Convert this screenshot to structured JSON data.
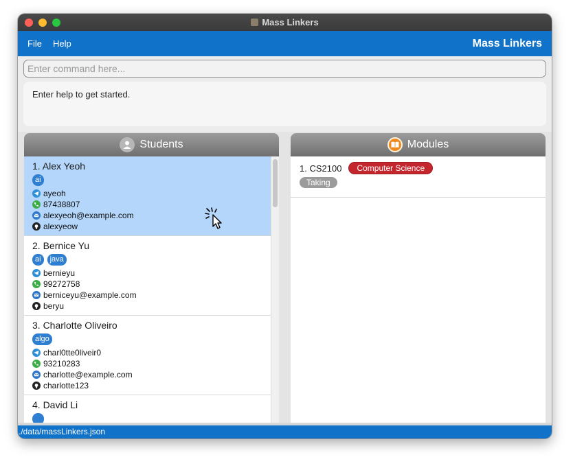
{
  "window": {
    "title": "Mass Linkers"
  },
  "menubar": {
    "file": "File",
    "help": "Help",
    "brand": "Mass Linkers"
  },
  "command": {
    "placeholder": "Enter command here...",
    "value": ""
  },
  "result": {
    "text": "Enter help to get started."
  },
  "students_panel": {
    "title": "Students",
    "icon": "user-icon",
    "items": [
      {
        "index_name": "1. Alex Yeoh",
        "tags": [
          "ai"
        ],
        "telegram": "ayeoh",
        "phone": "87438807",
        "email": "alexyeoh@example.com",
        "github": "alexyeow",
        "selected": true
      },
      {
        "index_name": "2. Bernice Yu",
        "tags": [
          "ai",
          "java"
        ],
        "telegram": "bernieyu",
        "phone": "99272758",
        "email": "berniceyu@example.com",
        "github": "beryu",
        "selected": false
      },
      {
        "index_name": "3. Charlotte Oliveiro",
        "tags": [
          "algo"
        ],
        "telegram": "charl0tte0liveir0",
        "phone": "93210283",
        "email": "charlotte@example.com",
        "github": "charlotte123",
        "selected": false
      },
      {
        "index_name": "4. David Li",
        "tags": [],
        "telegram": "",
        "phone": "",
        "email": "",
        "github": "",
        "selected": false
      }
    ]
  },
  "modules_panel": {
    "title": "Modules",
    "icon": "book-icon",
    "items": [
      {
        "index_code": "1. CS2100",
        "category": "Computer Science",
        "status": "Taking"
      }
    ]
  },
  "footer": {
    "path": "./data/massLinkers.json"
  },
  "colors": {
    "accent": "#1072c9",
    "selected": "#b4d6fb",
    "tag": "#2e7ed2",
    "module_tag": "#c4262e",
    "status": "#9b9b9b"
  }
}
